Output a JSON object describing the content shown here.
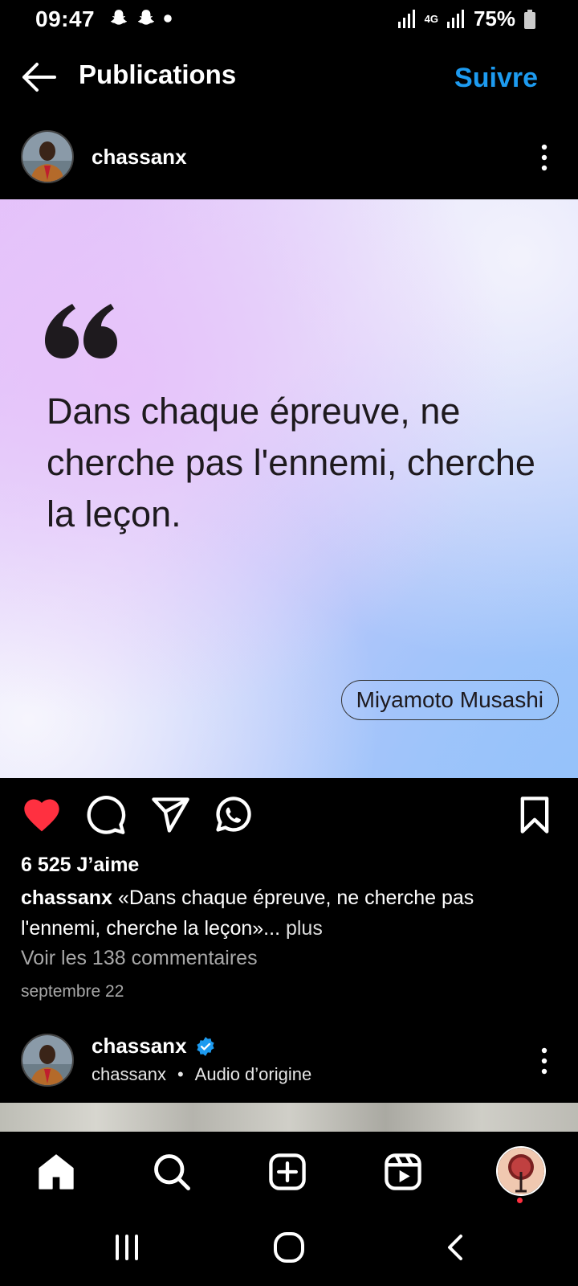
{
  "status_bar": {
    "time": "09:47",
    "network": "4G",
    "battery": "75%"
  },
  "header": {
    "title": "Publications",
    "follow_label": "Suivre"
  },
  "post": {
    "username": "chassanx",
    "quote_text": "Dans chaque épreuve, ne cherche pas l'ennemi, cherche la leçon.",
    "author": "Miyamoto Musashi",
    "liked": true,
    "likes_text": "6 525 J’aime",
    "caption_user": "chassanx",
    "caption_text": "«Dans chaque épreuve, ne cherche pas l'ennemi, cherche la leçon»...",
    "caption_more": "plus",
    "comments_text": "Voir les 138 commentaires",
    "date": "septembre 22",
    "colors": {
      "like": "#ff3040",
      "accent": "#1d9bf0"
    }
  },
  "next_post": {
    "username": "chassanx",
    "verified": true,
    "sub_user": "chassanx",
    "separator": "•",
    "audio": "Audio d’origine"
  },
  "bottom_nav": {
    "items": [
      "home-icon",
      "search-icon",
      "create-icon",
      "reels-icon",
      "profile-avatar"
    ]
  }
}
